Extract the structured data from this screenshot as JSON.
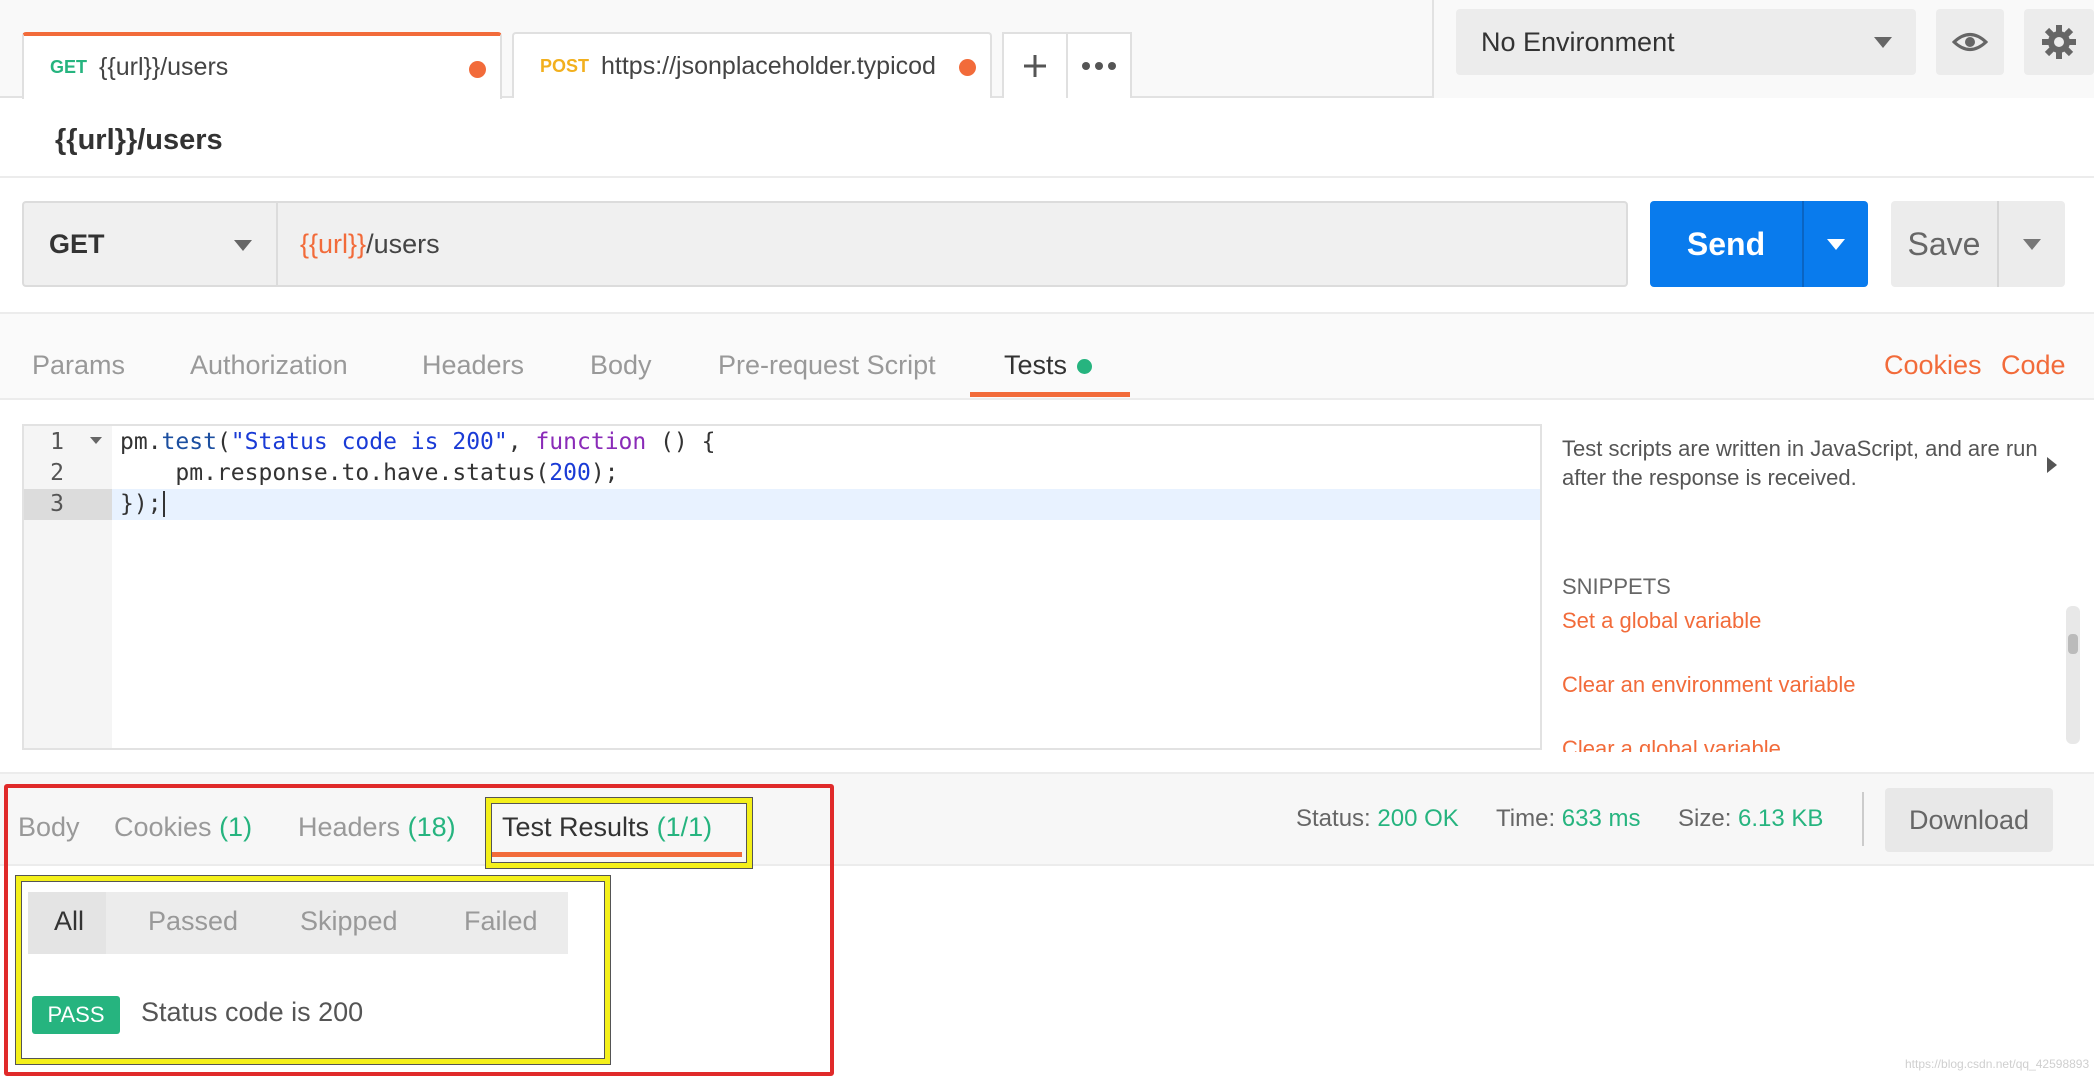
{
  "tabs": [
    {
      "method": "GET",
      "method_color": "#26b47f",
      "title": "{{url}}/users",
      "active": true,
      "unsaved": true
    },
    {
      "method": "POST",
      "method_color": "#f2b01e",
      "title": "https://jsonplaceholder.typicod",
      "active": false,
      "unsaved": true
    }
  ],
  "environment": {
    "selected": "No Environment"
  },
  "request": {
    "name": "{{url}}/users",
    "method": "GET",
    "url_variable": "{{url}}",
    "url_path": "/users",
    "send_label": "Send",
    "save_label": "Save"
  },
  "request_tabs": [
    "Params",
    "Authorization",
    "Headers",
    "Body",
    "Pre-request Script",
    "Tests"
  ],
  "request_links": {
    "cookies": "Cookies",
    "code": "Code"
  },
  "editor": {
    "line_numbers": [
      "1",
      "2",
      "3"
    ],
    "lines": [
      "pm.test(\"Status code is 200\", function () {",
      "    pm.response.to.have.status(200);",
      "});"
    ]
  },
  "side_panel": {
    "description": "Test scripts are written in JavaScript, and are run after the response is received.",
    "snippets_heading": "SNIPPETS",
    "snippets": [
      "Set a global variable",
      "Clear an environment variable",
      "Clear a global variable"
    ]
  },
  "response": {
    "tabs": [
      {
        "label": "Body",
        "count": ""
      },
      {
        "label": "Cookies",
        "count": "(1)"
      },
      {
        "label": "Headers",
        "count": "(18)"
      },
      {
        "label": "Test Results",
        "count": "(1/1)"
      }
    ],
    "status_label": "Status:",
    "status": "200 OK",
    "time_label": "Time:",
    "time": "633 ms",
    "size_label": "Size:",
    "size": "6.13 KB",
    "download_label": "Download"
  },
  "test_filters": [
    "All",
    "Passed",
    "Skipped",
    "Failed"
  ],
  "test_results": [
    {
      "badge": "PASS",
      "name": "Status code is 200"
    }
  ],
  "watermark": "https://blog.csdn.net/qq_42598893",
  "colors": {
    "accent": "#f26b3a",
    "primary": "#097bed",
    "success": "#26b47f",
    "annotation_red": "#e02a2a",
    "annotation_yellow": "#f4f01a"
  },
  "icons": {
    "add_tab": "plus-icon",
    "more_tabs": "ellipsis-icon",
    "env_quick_look": "eye-icon",
    "settings": "gear-icon"
  }
}
